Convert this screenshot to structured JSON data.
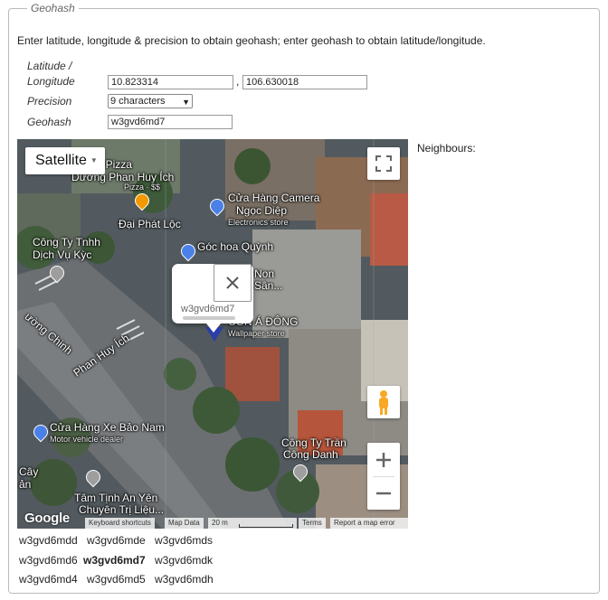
{
  "section": {
    "legend": "Geohash"
  },
  "intro": "Enter latitude, longitude & precision to obtain geohash; enter geohash to obtain latitude/longitude.",
  "form": {
    "latlon_label_1": "Latitude /",
    "latlon_label_2": "Longitude",
    "latitude": "10.823314",
    "comma": ",",
    "longitude": "106.630018",
    "precision_label": "Precision",
    "precision_value": "9 characters",
    "geohash_label": "Geohash",
    "geohash_value": "w3gvd6md7"
  },
  "neighbours_label": "Neighbours:",
  "map": {
    "type_button": "Satellite",
    "info_window_text": "w3gvd6md7",
    "google_logo": "Google",
    "attribution": {
      "shortcuts": "Keyboard shortcuts",
      "map_data": "Map Data",
      "scale": "20 m",
      "terms": "Terms",
      "report": "Report a map error"
    },
    "pois": {
      "pizza": "ino's Pizza",
      "pizza_sub": "Pizza · $$",
      "street_top": "Dương Phan Huy Ích",
      "dai_phat": "Đại Phát Lộc",
      "camera_1": "Cửa Hàng Camera",
      "camera_2": "Ngọc Diệp",
      "camera_sub": "Electronics store",
      "goc_hoa": "Góc hoa Quỳnh",
      "non_1": "Non",
      "non_2": "Sân...",
      "cong_ty_1": "Công Ty Tnhh",
      "cong_ty_2": "Dịch Vụ Kỳc",
      "con_a_dong": "CON Á ĐÔNG",
      "wallpaper": "Wallpaper store",
      "street_left": "ường Chinh",
      "street_mid": "Phan Huy Ích",
      "bao_nam": "Cửa Hàng Xe Bảo Nam",
      "bao_nam_sub": "Motor vehicle dealer",
      "tran_1": "Công Ty Trần",
      "tran_2": "Công Danh",
      "cay": "Cây",
      "san": "ản",
      "tam_1": "Tâm Tịnh An Yên",
      "tam_2": "Chuyên Trị Liệu..."
    }
  },
  "neighbours": [
    [
      "w3gvd6mdd",
      "w3gvd6mde",
      "w3gvd6mds"
    ],
    [
      "w3gvd6md6",
      "w3gvd6md7",
      "w3gvd6mdk"
    ],
    [
      "w3gvd6md4",
      "w3gvd6md5",
      "w3gvd6mdh"
    ]
  ]
}
